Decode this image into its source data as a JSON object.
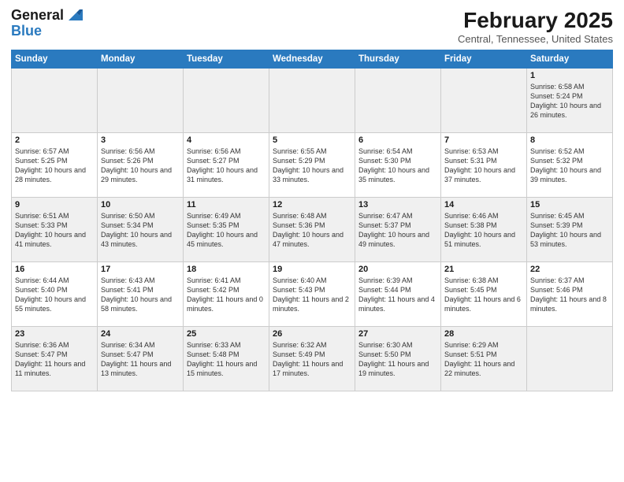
{
  "header": {
    "logo_line1": "General",
    "logo_line2": "Blue",
    "month": "February 2025",
    "location": "Central, Tennessee, United States"
  },
  "weekdays": [
    "Sunday",
    "Monday",
    "Tuesday",
    "Wednesday",
    "Thursday",
    "Friday",
    "Saturday"
  ],
  "weeks": [
    [
      {
        "day": "",
        "info": ""
      },
      {
        "day": "",
        "info": ""
      },
      {
        "day": "",
        "info": ""
      },
      {
        "day": "",
        "info": ""
      },
      {
        "day": "",
        "info": ""
      },
      {
        "day": "",
        "info": ""
      },
      {
        "day": "1",
        "info": "Sunrise: 6:58 AM\nSunset: 5:24 PM\nDaylight: 10 hours and 26 minutes."
      }
    ],
    [
      {
        "day": "2",
        "info": "Sunrise: 6:57 AM\nSunset: 5:25 PM\nDaylight: 10 hours and 28 minutes."
      },
      {
        "day": "3",
        "info": "Sunrise: 6:56 AM\nSunset: 5:26 PM\nDaylight: 10 hours and 29 minutes."
      },
      {
        "day": "4",
        "info": "Sunrise: 6:56 AM\nSunset: 5:27 PM\nDaylight: 10 hours and 31 minutes."
      },
      {
        "day": "5",
        "info": "Sunrise: 6:55 AM\nSunset: 5:29 PM\nDaylight: 10 hours and 33 minutes."
      },
      {
        "day": "6",
        "info": "Sunrise: 6:54 AM\nSunset: 5:30 PM\nDaylight: 10 hours and 35 minutes."
      },
      {
        "day": "7",
        "info": "Sunrise: 6:53 AM\nSunset: 5:31 PM\nDaylight: 10 hours and 37 minutes."
      },
      {
        "day": "8",
        "info": "Sunrise: 6:52 AM\nSunset: 5:32 PM\nDaylight: 10 hours and 39 minutes."
      }
    ],
    [
      {
        "day": "9",
        "info": "Sunrise: 6:51 AM\nSunset: 5:33 PM\nDaylight: 10 hours and 41 minutes."
      },
      {
        "day": "10",
        "info": "Sunrise: 6:50 AM\nSunset: 5:34 PM\nDaylight: 10 hours and 43 minutes."
      },
      {
        "day": "11",
        "info": "Sunrise: 6:49 AM\nSunset: 5:35 PM\nDaylight: 10 hours and 45 minutes."
      },
      {
        "day": "12",
        "info": "Sunrise: 6:48 AM\nSunset: 5:36 PM\nDaylight: 10 hours and 47 minutes."
      },
      {
        "day": "13",
        "info": "Sunrise: 6:47 AM\nSunset: 5:37 PM\nDaylight: 10 hours and 49 minutes."
      },
      {
        "day": "14",
        "info": "Sunrise: 6:46 AM\nSunset: 5:38 PM\nDaylight: 10 hours and 51 minutes."
      },
      {
        "day": "15",
        "info": "Sunrise: 6:45 AM\nSunset: 5:39 PM\nDaylight: 10 hours and 53 minutes."
      }
    ],
    [
      {
        "day": "16",
        "info": "Sunrise: 6:44 AM\nSunset: 5:40 PM\nDaylight: 10 hours and 55 minutes."
      },
      {
        "day": "17",
        "info": "Sunrise: 6:43 AM\nSunset: 5:41 PM\nDaylight: 10 hours and 58 minutes."
      },
      {
        "day": "18",
        "info": "Sunrise: 6:41 AM\nSunset: 5:42 PM\nDaylight: 11 hours and 0 minutes."
      },
      {
        "day": "19",
        "info": "Sunrise: 6:40 AM\nSunset: 5:43 PM\nDaylight: 11 hours and 2 minutes."
      },
      {
        "day": "20",
        "info": "Sunrise: 6:39 AM\nSunset: 5:44 PM\nDaylight: 11 hours and 4 minutes."
      },
      {
        "day": "21",
        "info": "Sunrise: 6:38 AM\nSunset: 5:45 PM\nDaylight: 11 hours and 6 minutes."
      },
      {
        "day": "22",
        "info": "Sunrise: 6:37 AM\nSunset: 5:46 PM\nDaylight: 11 hours and 8 minutes."
      }
    ],
    [
      {
        "day": "23",
        "info": "Sunrise: 6:36 AM\nSunset: 5:47 PM\nDaylight: 11 hours and 11 minutes."
      },
      {
        "day": "24",
        "info": "Sunrise: 6:34 AM\nSunset: 5:47 PM\nDaylight: 11 hours and 13 minutes."
      },
      {
        "day": "25",
        "info": "Sunrise: 6:33 AM\nSunset: 5:48 PM\nDaylight: 11 hours and 15 minutes."
      },
      {
        "day": "26",
        "info": "Sunrise: 6:32 AM\nSunset: 5:49 PM\nDaylight: 11 hours and 17 minutes."
      },
      {
        "day": "27",
        "info": "Sunrise: 6:30 AM\nSunset: 5:50 PM\nDaylight: 11 hours and 19 minutes."
      },
      {
        "day": "28",
        "info": "Sunrise: 6:29 AM\nSunset: 5:51 PM\nDaylight: 11 hours and 22 minutes."
      },
      {
        "day": "",
        "info": ""
      }
    ]
  ],
  "shaded_rows": [
    0,
    2,
    4
  ]
}
